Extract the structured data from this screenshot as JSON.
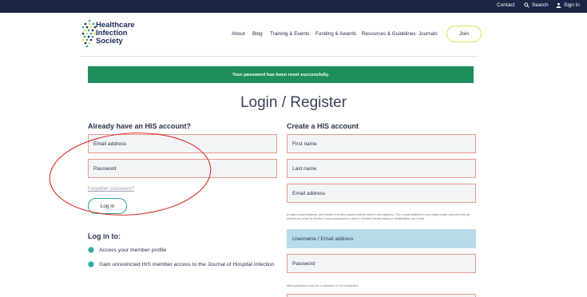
{
  "topbar": {
    "contact": "Contact",
    "search": "Search",
    "signin": "Sign in",
    "background_color": "#1b2544"
  },
  "header": {
    "logo_lines": [
      "Healthcare",
      "Infection",
      "Society"
    ],
    "nav": [
      "About",
      "Blog",
      "Training & Events",
      "Funding & Awards",
      "Resources & Guidelines",
      "Journals"
    ],
    "join_label": "Join",
    "join_border_color": "#d7e34f"
  },
  "banner": {
    "message": "Your password has been reset successfully.",
    "color": "#1d8f5a"
  },
  "page_title": "Login / Register",
  "login": {
    "heading": "Already have an HIS account?",
    "email_placeholder": "Email address",
    "password_placeholder": "Password",
    "forgot_label": "Forgotten password?",
    "button_label": "Log in",
    "button_border_color": "#2aa7a3"
  },
  "benefits": {
    "heading": "Log in to:",
    "items": [
      "Access your member profile",
      "Gain unrestricted HIS member access to the Journal of Hospital Infection"
    ]
  },
  "register": {
    "heading": "Create a HIS account",
    "first_name": "First name",
    "last_name": "Last name",
    "email": "Email address",
    "email_note": "A valid e-mail address. All e-mails from the system will be sent to this address. The e-mail address is not made public and will only be used if you wish to receive a new password or wish to receive certain news or notifications by e-mail.",
    "username_email": "Username / Email address",
    "password": "Password",
    "password_note": "New password must be a minimum of 10 characters",
    "highlight_color": "#b7dce9"
  },
  "annotation": {
    "color": "#d9302b"
  }
}
